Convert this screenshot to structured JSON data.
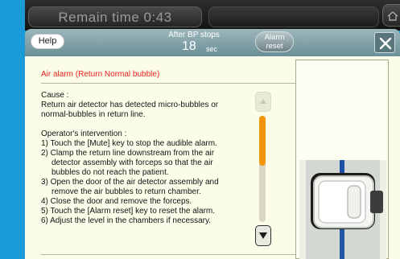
{
  "status_bar": {
    "remain_time": "Remain time 0:43",
    "home_icon": "home-icon"
  },
  "dialog": {
    "help_label": "Help",
    "bp_caption": "After BP stops",
    "bp_value": "18",
    "bp_unit": "sec",
    "alarm_reset_line1": "Alarm",
    "alarm_reset_line2": "reset",
    "close_icon": "close-icon"
  },
  "alarm": {
    "title": "Air alarm (Return Normal bubble)",
    "cause_heading": "Cause :",
    "cause_lines": [
      "Return air detector has detected micro-bubbles or",
      "normal-bubbles in return line."
    ],
    "intervention_heading": "Operator's intervention :",
    "steps": [
      {
        "first": "1) Touch the [Mute] key to stop the audible alarm.",
        "rest": []
      },
      {
        "first": "2) Clamp the return line downstream from the air",
        "rest": [
          "detector assembly with forceps so that the air",
          "bubbles do not reach the patient."
        ]
      },
      {
        "first": "3) Open the door of the air detector assembly and",
        "rest": [
          "remove the air bubbles to return chamber."
        ]
      },
      {
        "first": "4) Close the door and remove the forceps.",
        "rest": []
      },
      {
        "first": "5) Touch the [Alarm reset] key to reset the alarm.",
        "rest": []
      },
      {
        "first": "6) Adjust the level in the chambers if necessary.",
        "rest": []
      }
    ]
  },
  "scrollbar": {
    "position": 0.0,
    "visible_fraction": 0.47,
    "accent_color": "#f1960b",
    "up_icon": "scroll-up-icon",
    "down_icon": "scroll-down-icon"
  },
  "illustration": {
    "icon": "air-detector-photo"
  },
  "colors": {
    "frame_blue": "#1a9bd8",
    "alarm_red": "#e52020",
    "dialog_background": "#fbfde9"
  }
}
